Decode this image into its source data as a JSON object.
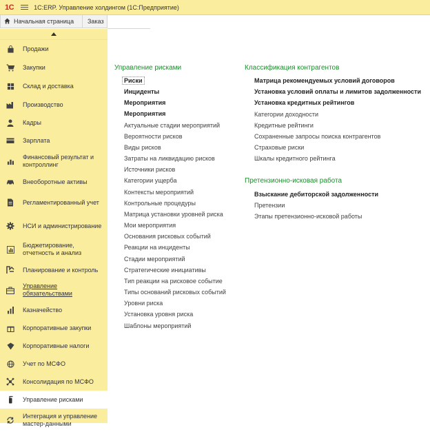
{
  "titlebar": {
    "logo": "1С",
    "title": "1С:ERP. Управление холдингом (1С:Предприятие)"
  },
  "tabs": {
    "home_label": "Начальная страница",
    "second_label": "Заказ"
  },
  "sidebar": {
    "items": [
      {
        "label": "Продажи",
        "icon": "shopping-bag-icon"
      },
      {
        "label": "Закупки",
        "icon": "cart-icon"
      },
      {
        "label": "Склад и доставка",
        "icon": "warehouse-icon"
      },
      {
        "label": "Производство",
        "icon": "factory-icon"
      },
      {
        "label": "Кадры",
        "icon": "person-icon"
      },
      {
        "label": "Зарплата",
        "icon": "wallet-icon"
      },
      {
        "label": "Финансовый результат и контроллинг",
        "icon": "bar-chart-icon"
      },
      {
        "label": "Внеоборотные активы",
        "icon": "car-icon"
      },
      {
        "label": "Регламентированный учет",
        "icon": "document-icon"
      },
      {
        "label": "НСИ и администрирование",
        "icon": "gear-icon"
      },
      {
        "label": "Бюджетирование, отчетность и анализ",
        "icon": "report-chart-icon"
      },
      {
        "label": "Планирование и контроль",
        "icon": "planning-icon"
      },
      {
        "label": "Управление обязательствами",
        "icon": "briefcase-icon"
      },
      {
        "label": "Казначейство",
        "icon": "treasury-icon"
      },
      {
        "label": "Корпоративные закупки",
        "icon": "gift-icon"
      },
      {
        "label": "Корпоративные налоги",
        "icon": "tax-icon"
      },
      {
        "label": "Учет по МСФО",
        "icon": "globe-icon"
      },
      {
        "label": "Консолидация по МСФО",
        "icon": "network-icon"
      },
      {
        "label": "Управление рисками",
        "icon": "fire-extinguisher-icon"
      },
      {
        "label": "Интеграция и управление мастер-данными",
        "icon": "sync-icon"
      }
    ]
  },
  "main": {
    "risk_section": {
      "title": "Управление рисками",
      "links": [
        "Риски",
        "Инциденты",
        "Мероприятия",
        "Мероприятия",
        "Актуальные стадии мероприятий",
        "Вероятности рисков",
        "Виды рисков",
        "Затраты на ликвидацию рисков",
        "Источники рисков",
        "Категории ущерба",
        "Контексты мероприятий",
        "Контрольные процедуры",
        "Матрица установки уровней риска",
        "Мои мероприятия",
        "Основания рисковых событий",
        "Реакции на инциденты",
        "Стадии мероприятий",
        "Стратегические инициативы",
        "Тип реакции на рисковое событие",
        "Типы оснований рисковых событий",
        "Уровни риска",
        "Установка уровня риска",
        "Шаблоны мероприятий"
      ]
    },
    "counterparty_section": {
      "title": "Классификация контрагентов",
      "links": [
        "Матрица рекомендуемых условий договоров",
        "Установка условий оплаты и лимитов задолженности",
        "Установка кредитных рейтингов",
        "Категории доходности",
        "Кредитные рейтинги",
        "Сохраненные запросы поиска контрагентов",
        "Страховые риски",
        "Шкалы кредитного рейтинга"
      ]
    },
    "claims_section": {
      "title": "Претензионно-исковая работа",
      "links": [
        "Взыскание дебиторской задолженности",
        "Претензии",
        "Этапы претензионно-исковой работы"
      ]
    }
  }
}
